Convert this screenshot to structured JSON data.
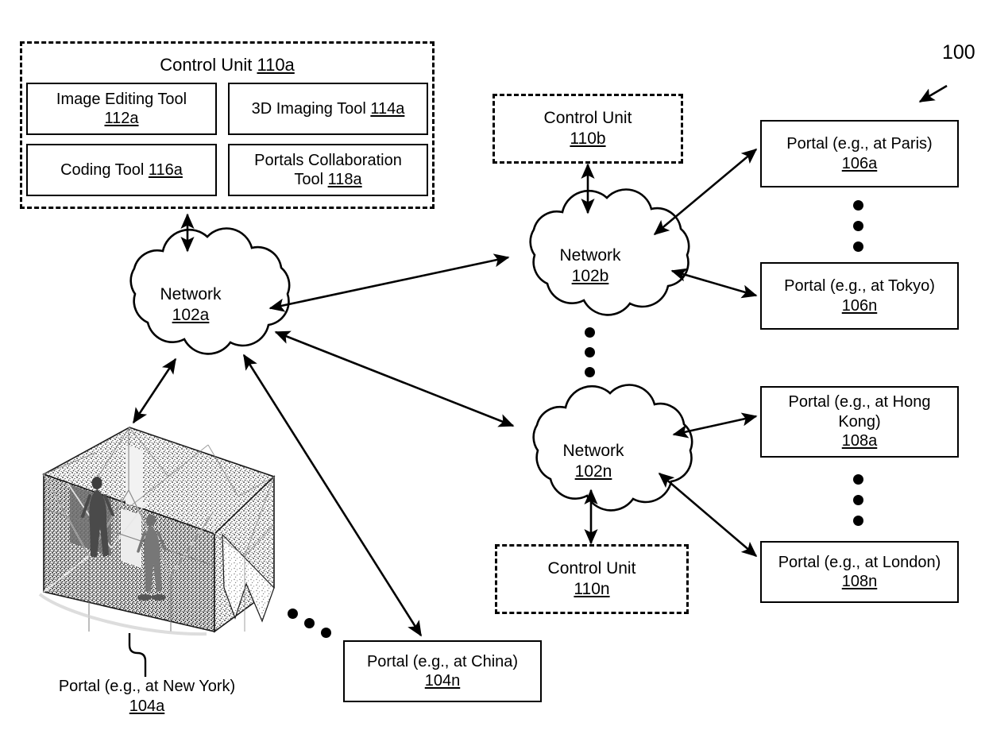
{
  "figure": {
    "number": "100",
    "title_ref": "100"
  },
  "control_units": {
    "primary": {
      "name": "Control Unit",
      "ref": "110a",
      "tools": [
        {
          "name": "Image Editing Tool",
          "ref": "112a",
          "two_line": true
        },
        {
          "name": "3D Imaging Tool",
          "ref": "114a",
          "two_line": false
        },
        {
          "name": "Coding Tool",
          "ref": "116a",
          "two_line": false
        },
        {
          "name": "Portals Collaboration Tool",
          "ref": "118a",
          "two_line": true
        }
      ]
    },
    "secondary": {
      "name": "Control Unit",
      "ref": "110b"
    },
    "tertiary": {
      "name": "Control Unit",
      "ref": "110n"
    }
  },
  "networks": [
    {
      "name": "Network",
      "ref": "102a"
    },
    {
      "name": "Network",
      "ref": "102b"
    },
    {
      "name": "Network",
      "ref": "102n"
    }
  ],
  "portals": {
    "new_york": {
      "label": "Portal (e.g., at New York)",
      "ref": "104a"
    },
    "china": {
      "label": "Portal (e.g., at China)",
      "ref": "104n"
    },
    "paris": {
      "label": "Portal (e.g., at Paris)",
      "ref": "106a"
    },
    "tokyo": {
      "label": "Portal (e.g., at Tokyo)",
      "ref": "106n"
    },
    "hong_kong_line1": "Portal (e.g., at Hong",
    "hong_kong_line2": "Kong)",
    "hong_kong_ref": "108a",
    "london": {
      "label": "Portal (e.g., at London)",
      "ref": "108n"
    }
  },
  "tool_labels": {
    "image_editing_l1": "Image Editing Tool",
    "image_editing_l2": "112a",
    "imaging_3d": "3D Imaging Tool",
    "imaging_3d_ref": "114a",
    "coding": "Coding Tool",
    "coding_ref": "116a",
    "portals_collab_l1": "Portals Collaboration",
    "portals_collab_l2": "Tool",
    "portals_collab_ref": "118a"
  },
  "colors": {
    "stroke": "#000000",
    "background": "#ffffff",
    "portal_fill": "#9a9a9a"
  }
}
